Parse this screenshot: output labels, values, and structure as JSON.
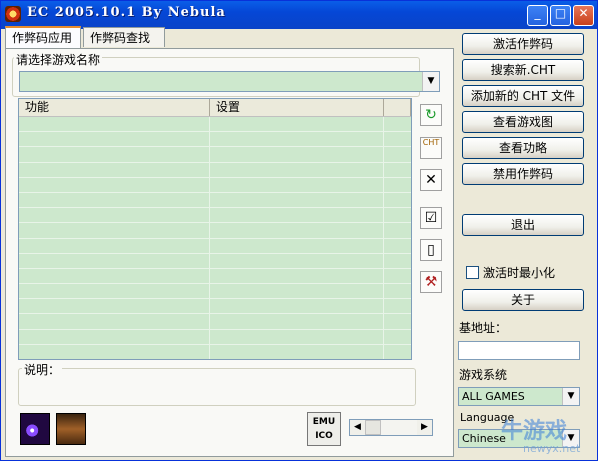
{
  "window": {
    "title": "EC 2005.10.1  By Nebula"
  },
  "titlebar_buttons": {
    "minimize": "_",
    "maximize": "□",
    "close": "✕"
  },
  "tabs": [
    {
      "label": "作弊码应用"
    },
    {
      "label": "作弊码查找"
    }
  ],
  "game_select": {
    "label": "请选择游戏名称",
    "value": ""
  },
  "cheat_list": {
    "columns": [
      "功能",
      "设置",
      ""
    ],
    "rows": 17
  },
  "side_icons": [
    "refresh-icon",
    "open-cht-icon",
    "delete-icon",
    "check-list-icon",
    "toggle-panel-icon",
    "tools-icon"
  ],
  "side_icon_glyphs": [
    "↻",
    "CHT",
    "✕",
    "☑",
    "▯",
    "⚒"
  ],
  "description": {
    "label": "说明："
  },
  "emu_icon": {
    "glyph": "EMU ICO"
  },
  "buttons": [
    {
      "label": "激活作弊码"
    },
    {
      "label": "搜索新.CHT"
    },
    {
      "label": "添加新的 CHT 文件"
    },
    {
      "label": "查看游戏图"
    },
    {
      "label": "查看功略"
    },
    {
      "label": "禁用作弊码"
    }
  ],
  "exit_button": {
    "label": "退出"
  },
  "minimize_checkbox": {
    "label": "激活时最小化",
    "checked": false
  },
  "about_button": {
    "label": "关于"
  },
  "base_address": {
    "label": "基地址：",
    "value": ""
  },
  "game_system": {
    "label": "游戏系统",
    "value": "ALL GAMES"
  },
  "language": {
    "label": "Language",
    "value": "Chinese"
  },
  "watermark": {
    "brand": "牛游戏",
    "url": "newyx.net"
  },
  "colors": {
    "titlebar": "#0a5ee8",
    "list_bg": "#cde8cd",
    "window_bg": "#ece9d8",
    "accent_tab": "#e68b2c"
  }
}
